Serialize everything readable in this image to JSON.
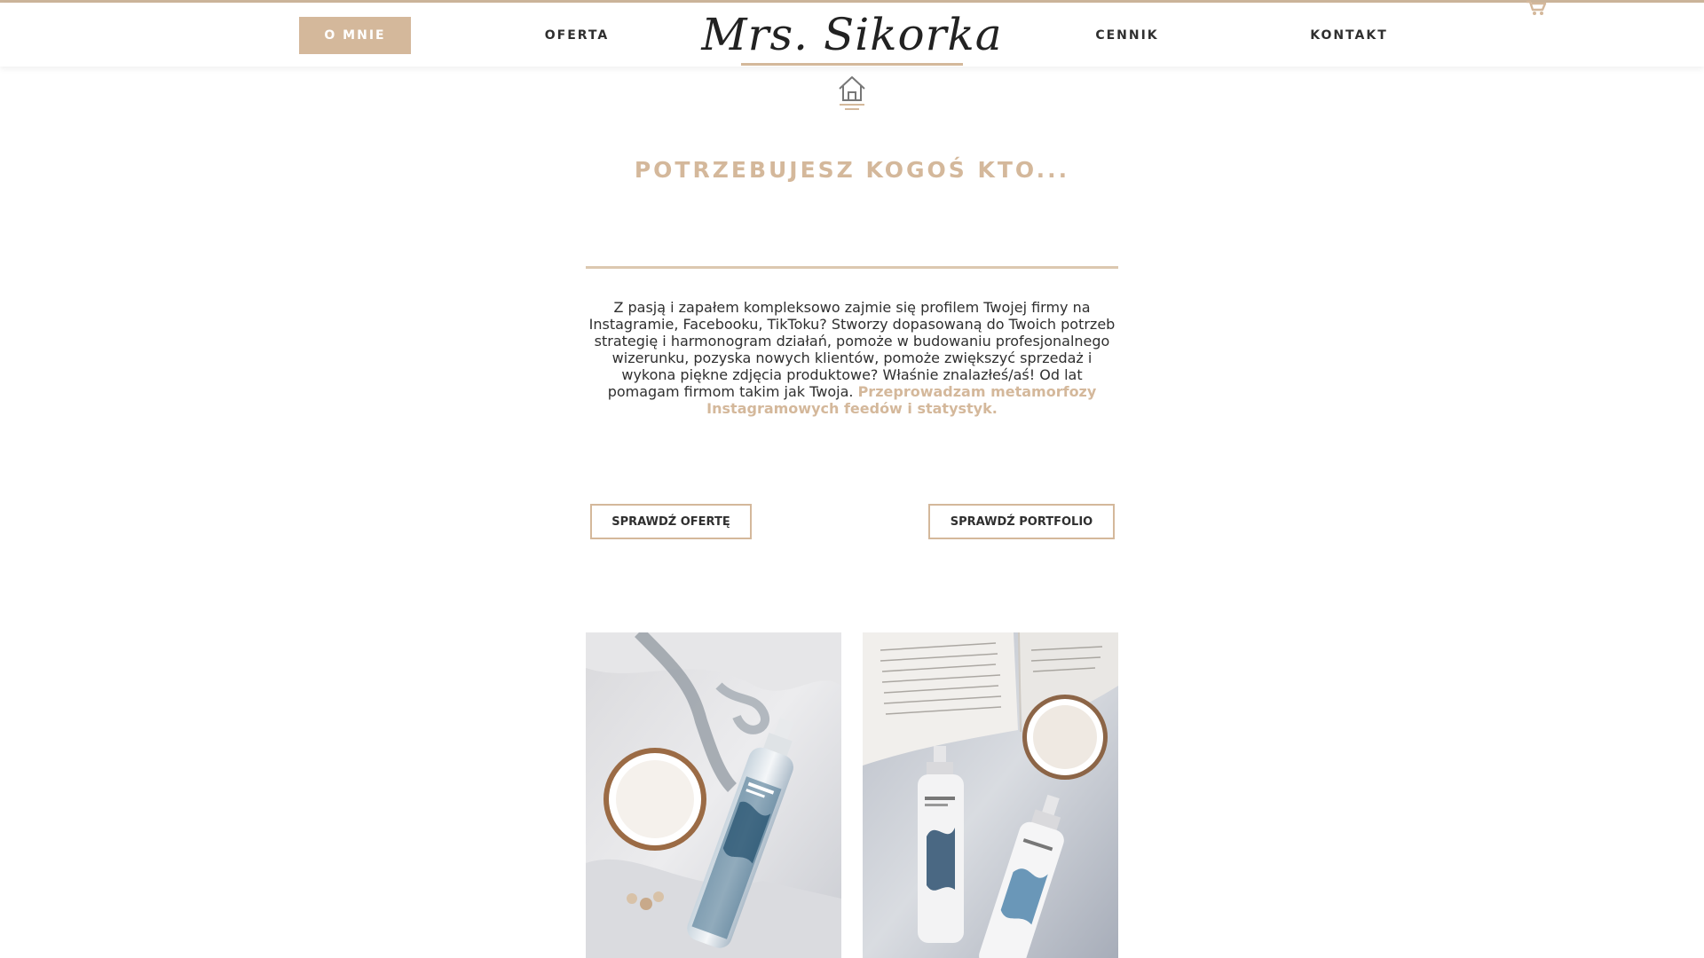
{
  "brand": {
    "logo_text": "Mrs. Sikorka",
    "accent_color": "#d4b89b"
  },
  "nav": {
    "items": [
      {
        "label": "O MNIE",
        "active": true
      },
      {
        "label": "OFERTA",
        "active": false
      },
      {
        "label": "CENNIK",
        "active": false
      },
      {
        "label": "KONTAKT",
        "active": false
      }
    ],
    "cart_icon": "cart-icon",
    "home_icon": "home-icon"
  },
  "hero": {
    "headline": "POTRZEBUJESZ KOGOŚ KTO...",
    "intro_text": "Z pasją i zapałem kompleksowo zajmie się profilem Twojej firmy na Instagramie, Facebooku, TikToku? Stworzy dopasowaną do Twoich potrzeb strategię i harmonogram działań, pomoże w budowaniu profesjonalnego wizerunku, pozyska nowych klientów, pomoże zwiększyć sprzedaż i wykona piękne zdjęcia produktowe? Właśnie znalazłeś/aś! Od lat pomagam firmom takim jak Twoja.",
    "intro_accent": "Przeprowadzam metamorfozy Instagramowych feedów i statystyk.",
    "buttons": {
      "offer": "SPRAWDŹ OFERTĘ",
      "portfolio": "SPRAWDŹ PORTFOLIO"
    }
  },
  "gallery": {
    "images": [
      "product-photo-cosmetics-cup",
      "product-photo-cosmetics-book"
    ]
  }
}
